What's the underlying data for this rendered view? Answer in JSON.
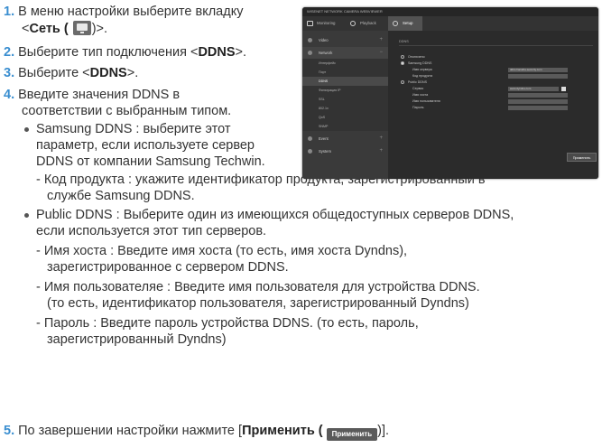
{
  "steps": {
    "s1": {
      "num": "1.",
      "line1": "В меню настройки выберите вкладку",
      "pre": "<",
      "bold": "Сеть (",
      "post": ")>."
    },
    "s2": {
      "num": "2.",
      "pre": "Выберите тип подключения <",
      "bold": "DDNS",
      "post": ">."
    },
    "s3": {
      "num": "3.",
      "pre": "Выберите <",
      "bold": "DDNS",
      "post": ">."
    },
    "s4": {
      "num": "4.",
      "line1": "Введите значения DDNS в",
      "line2": "соответствии с выбранным типом."
    },
    "samsung": {
      "line1": "Samsung DDNS : выберите этот",
      "line2": "параметр, если используете сервер",
      "line3": "DDNS от компании Samsung Techwin."
    },
    "product": {
      "line1": "- Код продукта : укажите идентификатор продукта, зарегистрированный в",
      "line2": "службе Samsung DDNS."
    },
    "public": {
      "line1": "Public DDNS : Выберите один из имеющихся общедоступных серверов DDNS,",
      "line2": "если используется этот тип серверов."
    },
    "host": {
      "line1": "- Имя хоста : Введите имя хоста (то есть, имя хоста Dyndns),",
      "line2": "зарегистрированное с сервером DDNS."
    },
    "user": {
      "line1": "- Имя пользователяе : Введите имя пользователя для устройства DDNS.",
      "line2": "(то есть, идентификатор пользователя, зарегистрированный Dyndns)"
    },
    "pass": {
      "line1": "- Пароль : Введите пароль устройства DDNS. (то есть, пароль,",
      "line2": "зарегистрированный Dyndns)"
    },
    "s5": {
      "num": "5.",
      "pre": "По завершении настройки нажмите [",
      "bold": "Применить (",
      "btn": "Применить",
      "post": ")]."
    }
  },
  "screenshot": {
    "topbar": "WISENET NETWORK CAMERA WEBVIEWER",
    "tabs": [
      "Monitoring",
      "Playback",
      "Setup"
    ],
    "sidebar": [
      "Video",
      "Network",
      "Event",
      "System"
    ],
    "submenu": [
      "Интерфейс",
      "Порт",
      "DDNS",
      "Фильтрация IP",
      "SSL",
      "802.1x",
      "QoS",
      "SNMP"
    ],
    "main_title": "DDNS",
    "radio_off": "Отключено",
    "radio_samsung": "Samsung DDNS",
    "samsung_fields": [
      "Имя сервера",
      "Код продукта"
    ],
    "samsung_values": [
      "ddns.hanwha-security.com",
      ""
    ],
    "radio_public": "Public DDNS",
    "public_fields": [
      "Сервис",
      "Имя хоста",
      "Имя пользователя",
      "Пароль"
    ],
    "public_values": [
      "www.dyndns.com",
      "",
      "",
      ""
    ],
    "apply": "Применить"
  }
}
